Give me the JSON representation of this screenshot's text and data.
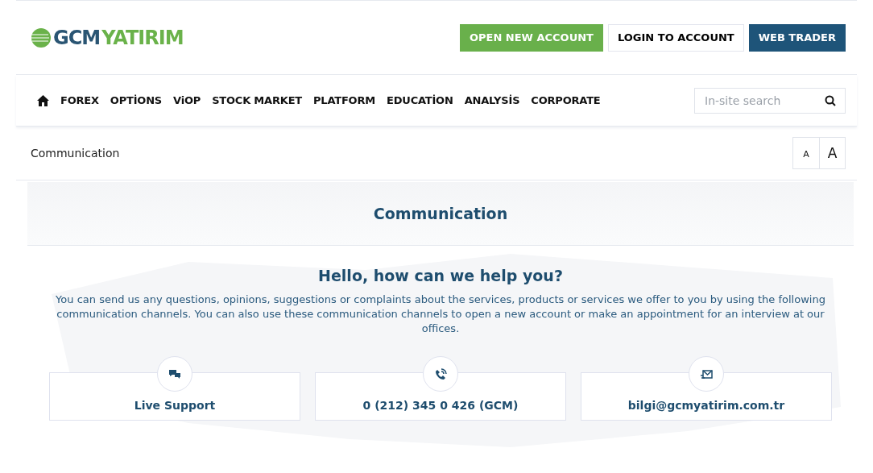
{
  "logo": {
    "part_1": "GCM",
    "part_2": "YATIRIM"
  },
  "header_buttons": [
    {
      "label": "OPEN NEW ACCOUNT",
      "kind": "primary"
    },
    {
      "label": "LOGIN TO ACCOUNT",
      "kind": "outline"
    },
    {
      "label": "WEB TRADER",
      "kind": "dark"
    }
  ],
  "nav": {
    "items": [
      "FOREX",
      "OPTİONS",
      "ViOP",
      "STOCK MARKET",
      "PLATFORM",
      "EDUCATİON",
      "ANALYSİS",
      "CORPORATE"
    ]
  },
  "search": {
    "placeholder": "In-site search"
  },
  "breadcrumb": "Communication",
  "font_size_buttons": [
    "A",
    "A"
  ],
  "page_title": "Communication",
  "heading": "Hello, how can we help you?",
  "intro": "You can send us any questions, opinions, suggestions or complaints about the services, products or services we offer to you by using the following communication channels. You can also use these communication channels to open a new account or make an appointment for an interview at our offices.",
  "channels": [
    {
      "kind": "chat",
      "label": "Live Support"
    },
    {
      "kind": "phone",
      "label": "0 (212) 345 0 426 (GCM)"
    },
    {
      "kind": "mail",
      "label": "bilgi@gcmyatirim.com.tr"
    }
  ]
}
